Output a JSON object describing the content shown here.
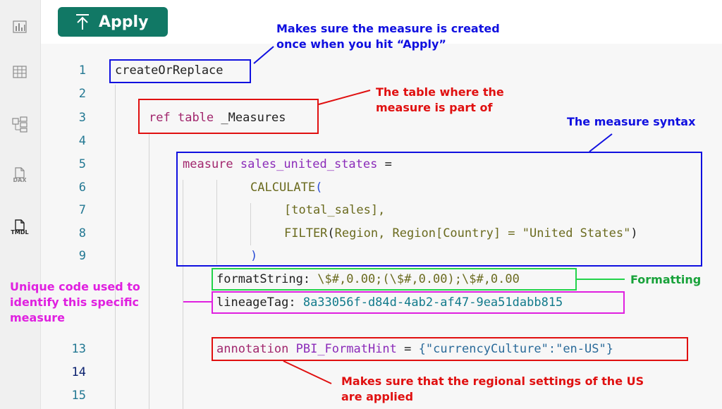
{
  "toolbar": {
    "apply_label": "Apply",
    "apply_icon": "upload-arrow-icon"
  },
  "sidebar": {
    "icons": [
      "report-view-icon",
      "table-view-icon",
      "model-view-icon",
      "dax-query-icon",
      "tmdl-view-icon"
    ],
    "dax_label": "DAX",
    "tmdl_label": "TMDL"
  },
  "editor": {
    "line_numbers": [
      "1",
      "2",
      "3",
      "4",
      "5",
      "6",
      "7",
      "8",
      "9",
      "13",
      "14",
      "15"
    ],
    "line1": "createOrReplace",
    "line3": {
      "kw": "ref",
      "kw2": "table",
      "name": "_Measures"
    },
    "line5": {
      "kw": "measure",
      "name": "sales_united_states",
      "eq": "="
    },
    "line6": {
      "fn": "CALCULATE",
      "paren": "("
    },
    "line7": "[total_sales],",
    "line8": {
      "fn": "FILTER",
      "open": "(",
      "args": "Region, Region[Country] = ",
      "str": "\"United States\"",
      "close": ")"
    },
    "line9": ")",
    "format": {
      "key": "formatString:",
      "value": " \\$#,0.00;(\\$#,0.00);\\$#,0.00"
    },
    "lineage": {
      "key": "lineageTag:",
      "value": " 8a33056f-d84d-4ab2-af47-9ea51dabb815"
    },
    "annotation": {
      "kw": "annotation",
      "name": "PBI_FormatHint",
      "eq": " = ",
      "value": "{\"currencyCulture\":\"en-US\"}"
    }
  },
  "annotations": {
    "apply": [
      "Makes sure the measure is created",
      "once when you hit “Apply”"
    ],
    "table": [
      "The table where the",
      "measure is part of"
    ],
    "syntax": "The measure syntax",
    "formatting": "Formatting",
    "lineage": [
      "Unique code used to",
      "identify this specific",
      "measure"
    ],
    "regional": [
      "Makes sure that the regional settings of the US",
      "are applied"
    ]
  },
  "colors": {
    "apply_button": "#117865",
    "blue_box": "#1010e0",
    "red_box": "#e01010",
    "green_box": "#22d34a",
    "magenta_box": "#e020e0"
  }
}
